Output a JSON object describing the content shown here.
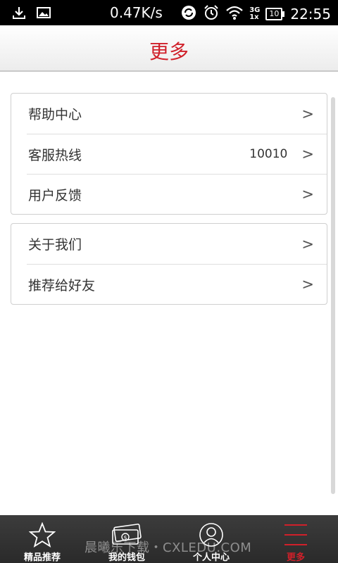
{
  "status_bar": {
    "speed": "0.47K/s",
    "network": "3G",
    "network_secondary": "1x",
    "battery": "10",
    "time": "22:55"
  },
  "header": {
    "title": "更多"
  },
  "menu_groups": [
    {
      "items": [
        {
          "label": "帮助中心",
          "value": "",
          "chevron": ">"
        },
        {
          "label": "客服热线",
          "value": "10010",
          "chevron": ">"
        },
        {
          "label": "用户反馈",
          "value": "",
          "chevron": ">"
        }
      ]
    },
    {
      "items": [
        {
          "label": "关于我们",
          "value": "",
          "chevron": ">"
        },
        {
          "label": "推荐给好友",
          "value": "",
          "chevron": ">"
        }
      ]
    }
  ],
  "bottom_nav": {
    "items": [
      {
        "label": "精品推荐",
        "icon": "star-icon"
      },
      {
        "label": "我的钱包",
        "icon": "wallet-icon"
      },
      {
        "label": "个人中心",
        "icon": "person-icon"
      },
      {
        "label": "更多",
        "icon": "menu-icon",
        "active": true
      }
    ]
  },
  "watermark": "晨曦乐下载・CXLEDU.COM",
  "colors": {
    "accent": "#d0202a",
    "nav_bg": "#333333"
  }
}
